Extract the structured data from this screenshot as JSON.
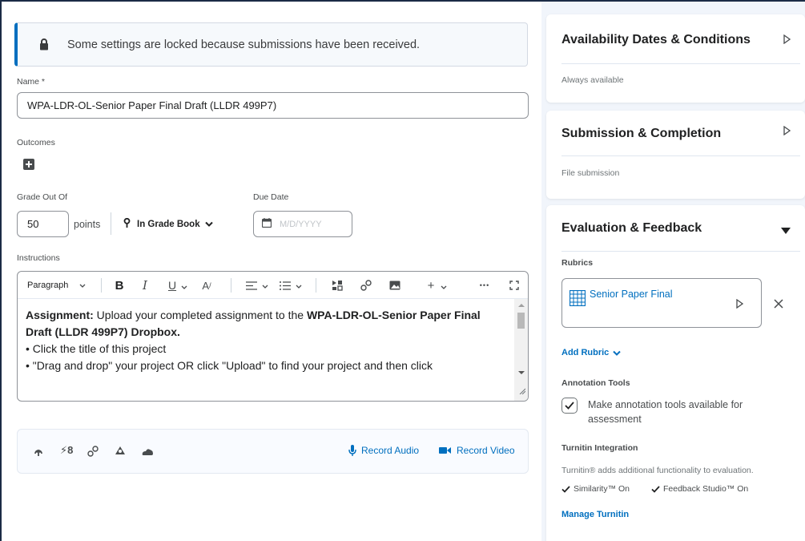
{
  "alert": {
    "message": "Some settings are locked because submissions have been received."
  },
  "form": {
    "name_label": "Name *",
    "name_value": "WPA-LDR-OL-Senior Paper Final Draft (LLDR 499P7)",
    "outcomes_label": "Outcomes",
    "grade_label": "Grade Out Of",
    "grade_value": "50",
    "points_label": "points",
    "gradebook_label": "In Grade Book",
    "due_label": "Due Date",
    "due_placeholder": "M/D/YYYY",
    "instructions_label": "Instructions"
  },
  "toolbar": {
    "paragraph_label": "Paragraph",
    "more_label": "•••"
  },
  "editor": {
    "line1_bold": "Assignment:",
    "line1_text": " Upload your completed assignment to the ",
    "line1_bold2": "WPA-LDR-OL-Senior Paper Final Draft (LLDR 499P7) Dropbox.",
    "bullet1": "• Click the title of this project",
    "bullet2": "• \"Drag and drop\" your project OR click \"Upload\" to find your project and then click"
  },
  "attachments": {
    "record_audio": "Record Audio",
    "record_video": "Record Video"
  },
  "sidebar": {
    "availability": {
      "title": "Availability Dates & Conditions",
      "summary": "Always available"
    },
    "submission": {
      "title": "Submission & Completion",
      "summary": "File submission"
    },
    "evaluation": {
      "title": "Evaluation & Feedback",
      "rubrics_label": "Rubrics",
      "rubric_name": "Senior Paper Final",
      "add_rubric": "Add Rubric",
      "annotation_label": "Annotation Tools",
      "annotation_checkbox": "Make annotation tools available for assessment",
      "annotation_checked": true,
      "turnitin_label": "Turnitin Integration",
      "turnitin_desc": "Turnitin® adds additional functionality to evaluation.",
      "similarity_status": "Similarity™ On",
      "feedback_status": "Feedback Studio™ On",
      "manage_turnitin": "Manage Turnitin"
    }
  },
  "colors": {
    "accent": "#006fbf",
    "border": "#8e9298",
    "background": "#f1f5fb"
  }
}
